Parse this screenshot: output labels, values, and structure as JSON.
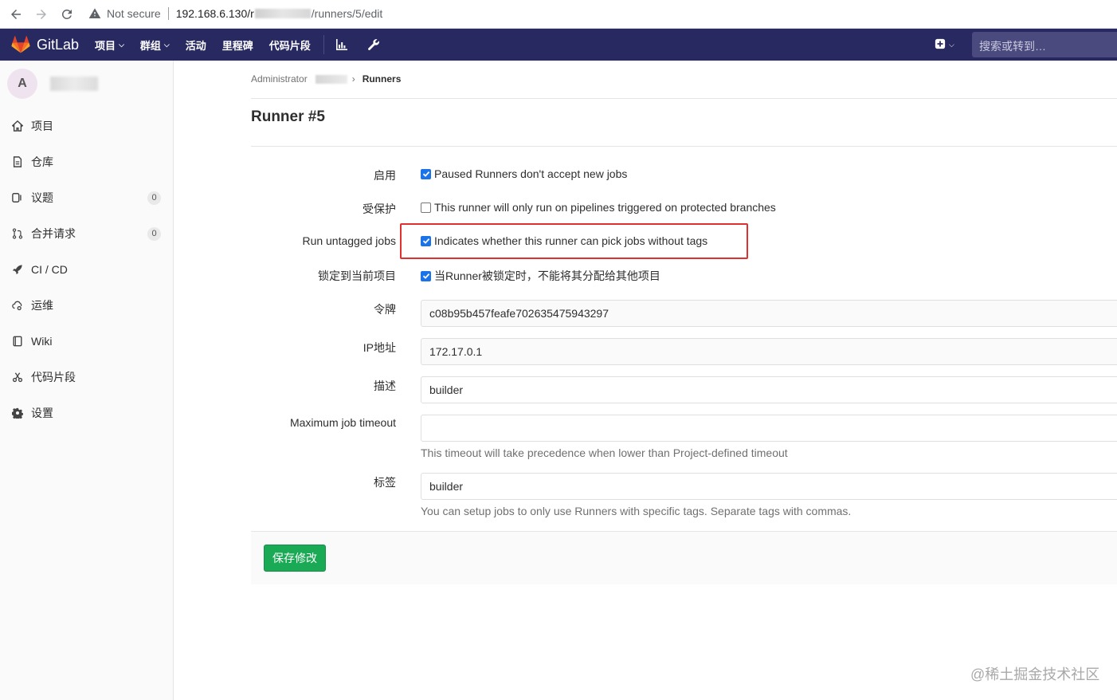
{
  "browser": {
    "not_secure": "Not secure",
    "url_host": "192.168.6.130/r",
    "url_path": "/runners/5/edit"
  },
  "header": {
    "logo_text": "GitLab",
    "menu": [
      {
        "label": "项目",
        "has_caret": true
      },
      {
        "label": "群组",
        "has_caret": true
      },
      {
        "label": "活动",
        "has_caret": false
      },
      {
        "label": "里程碑",
        "has_caret": false
      },
      {
        "label": "代码片段",
        "has_caret": false
      }
    ],
    "search_placeholder": "搜索或转到…"
  },
  "sidebar": {
    "avatar_letter": "A",
    "items": [
      {
        "label": "项目",
        "icon": "home-icon"
      },
      {
        "label": "仓库",
        "icon": "doc-icon"
      },
      {
        "label": "议题",
        "icon": "issues-icon",
        "badge": "0"
      },
      {
        "label": "合并请求",
        "icon": "merge-request-icon",
        "badge": "0"
      },
      {
        "label": "CI / CD",
        "icon": "rocket-icon"
      },
      {
        "label": "运维",
        "icon": "cloud-gear-icon"
      },
      {
        "label": "Wiki",
        "icon": "book-icon"
      },
      {
        "label": "代码片段",
        "icon": "scissors-icon"
      },
      {
        "label": "设置",
        "icon": "gear-icon"
      }
    ]
  },
  "breadcrumb": {
    "root": "Administrator",
    "current": "Runners"
  },
  "page": {
    "title": "Runner #5"
  },
  "form": {
    "active": {
      "label": "启用",
      "text": "Paused Runners don't accept new jobs",
      "checked": true
    },
    "protected": {
      "label": "受保护",
      "text": "This runner will only run on pipelines triggered on protected branches",
      "checked": false
    },
    "run_untagged": {
      "label": "Run untagged jobs",
      "text": "Indicates whether this runner can pick jobs without tags",
      "checked": true
    },
    "locked": {
      "label": "锁定到当前项目",
      "text": "当Runner被锁定时，不能将其分配给其他项目",
      "checked": true
    },
    "token": {
      "label": "令牌",
      "value": "c08b95b457feafe702635475943297"
    },
    "ip": {
      "label": "IP地址",
      "value": "172.17.0.1"
    },
    "description": {
      "label": "描述",
      "value": "builder"
    },
    "timeout": {
      "label": "Maximum job timeout",
      "value": "",
      "help": "This timeout will take precedence when lower than Project-defined timeout"
    },
    "tags": {
      "label": "标签",
      "value": "builder",
      "help": "You can setup jobs to only use Runners with specific tags. Separate tags with commas."
    },
    "save_label": "保存修改"
  },
  "watermark": "@稀土掘金技术社区",
  "colors": {
    "header_bg": "#292961",
    "save_button": "#1aaa55",
    "highlight_box": "#e0302f",
    "checkbox": "#1a73e8"
  }
}
